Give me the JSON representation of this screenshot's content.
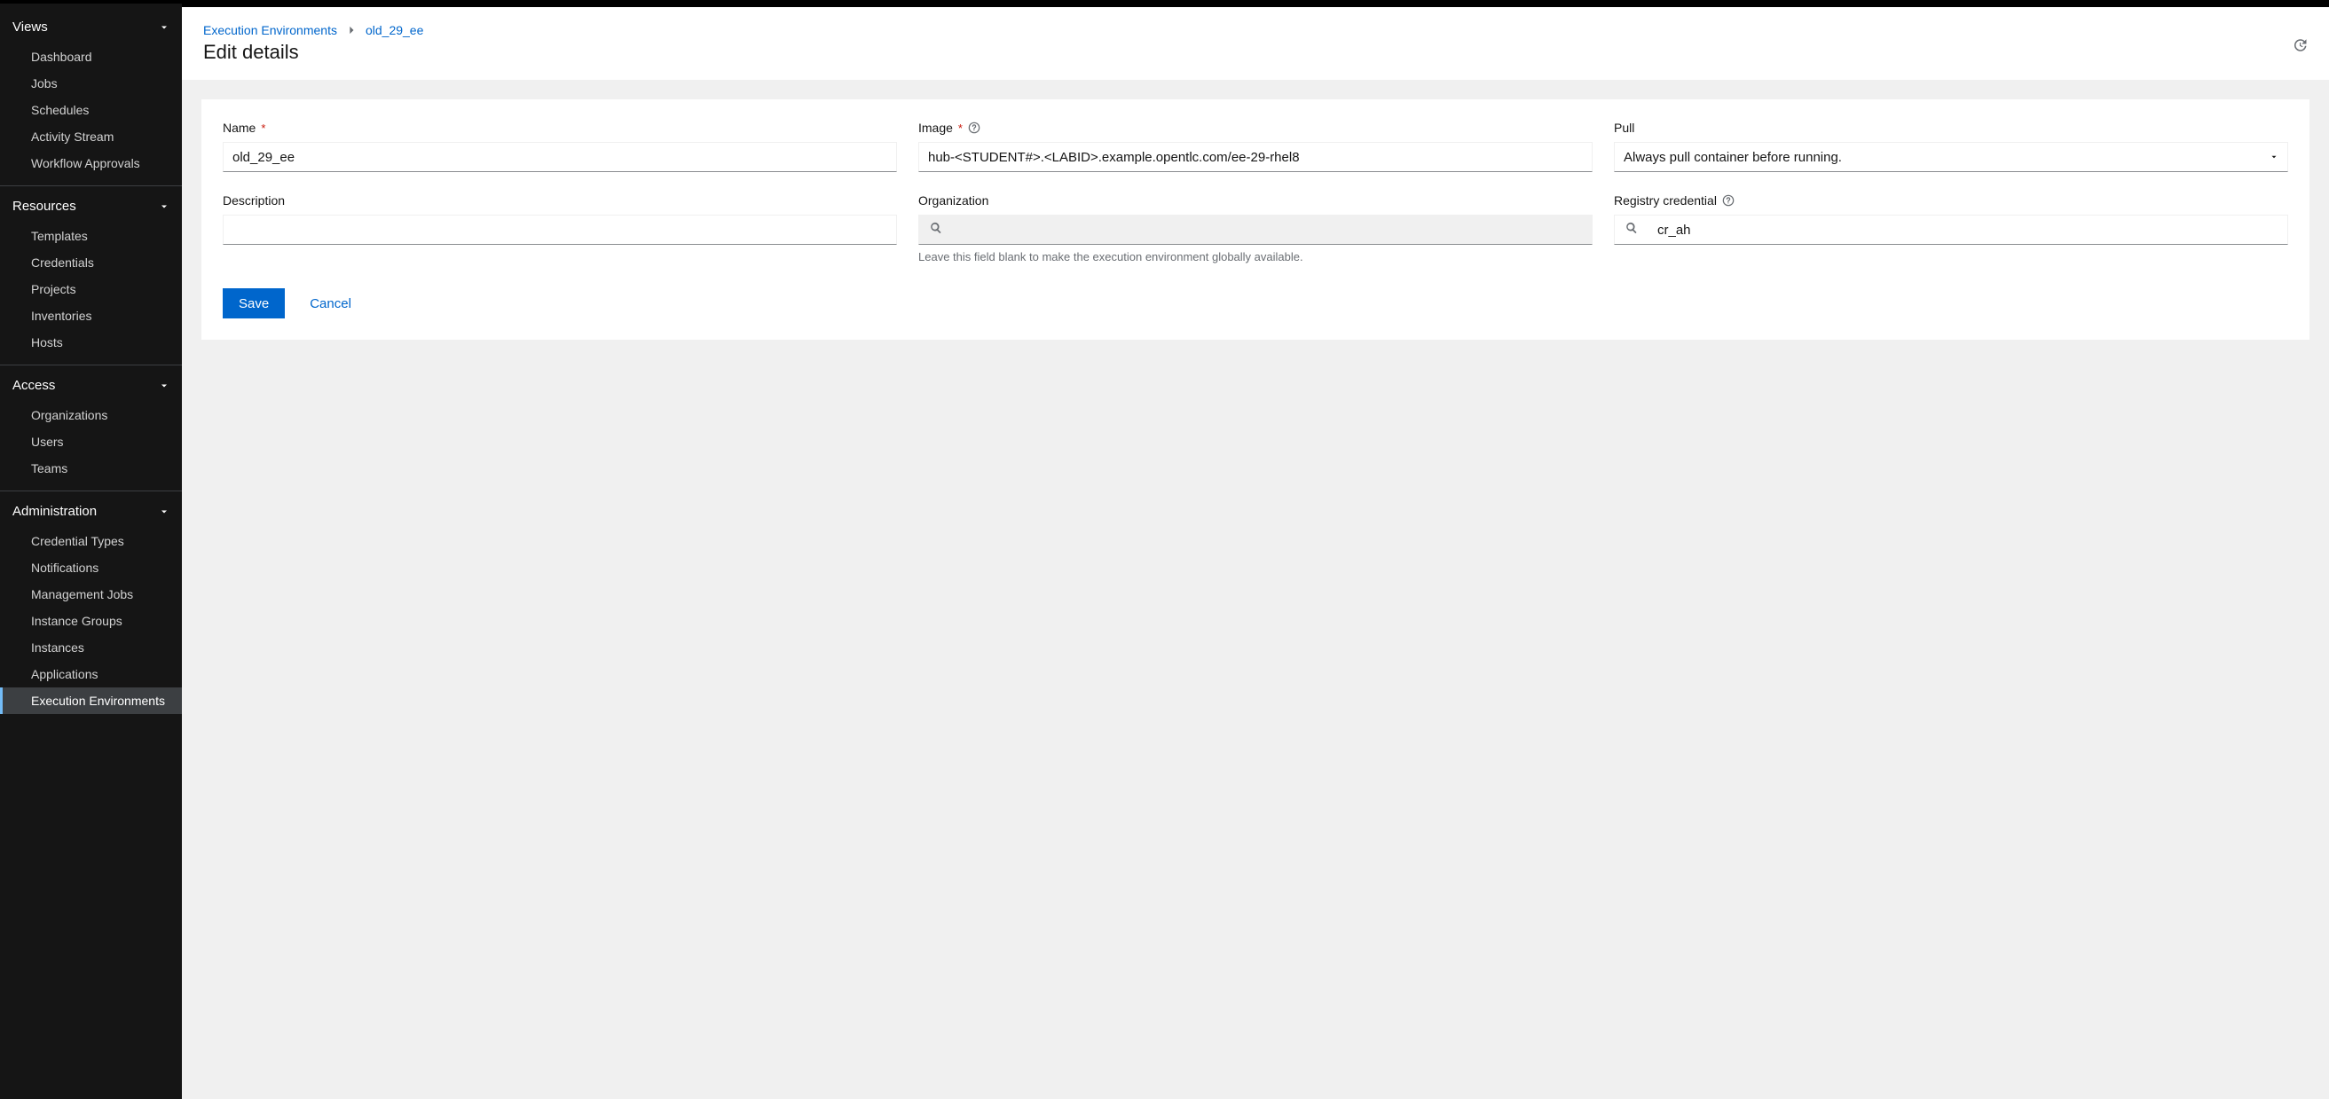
{
  "sidebar": {
    "sections": [
      {
        "label": "Views",
        "items": [
          {
            "label": "Dashboard"
          },
          {
            "label": "Jobs"
          },
          {
            "label": "Schedules"
          },
          {
            "label": "Activity Stream"
          },
          {
            "label": "Workflow Approvals"
          }
        ]
      },
      {
        "label": "Resources",
        "items": [
          {
            "label": "Templates"
          },
          {
            "label": "Credentials"
          },
          {
            "label": "Projects"
          },
          {
            "label": "Inventories"
          },
          {
            "label": "Hosts"
          }
        ]
      },
      {
        "label": "Access",
        "items": [
          {
            "label": "Organizations"
          },
          {
            "label": "Users"
          },
          {
            "label": "Teams"
          }
        ]
      },
      {
        "label": "Administration",
        "items": [
          {
            "label": "Credential Types"
          },
          {
            "label": "Notifications"
          },
          {
            "label": "Management Jobs"
          },
          {
            "label": "Instance Groups"
          },
          {
            "label": "Instances"
          },
          {
            "label": "Applications"
          },
          {
            "label": "Execution Environments"
          }
        ]
      }
    ]
  },
  "breadcrumbs": {
    "root": "Execution Environments",
    "leaf": "old_29_ee"
  },
  "page": {
    "title": "Edit details"
  },
  "form": {
    "name": {
      "label": "Name",
      "value": "old_29_ee"
    },
    "image": {
      "label": "Image",
      "value": "hub-<STUDENT#>.<LABID>.example.opentlc.com/ee-29-rhel8"
    },
    "pull": {
      "label": "Pull",
      "value": "Always pull container before running."
    },
    "description": {
      "label": "Description",
      "value": ""
    },
    "organization": {
      "label": "Organization",
      "value": "",
      "helper": "Leave this field blank to make the execution environment globally available."
    },
    "registry_credential": {
      "label": "Registry credential",
      "value": "cr_ah"
    },
    "save_label": "Save",
    "cancel_label": "Cancel"
  }
}
